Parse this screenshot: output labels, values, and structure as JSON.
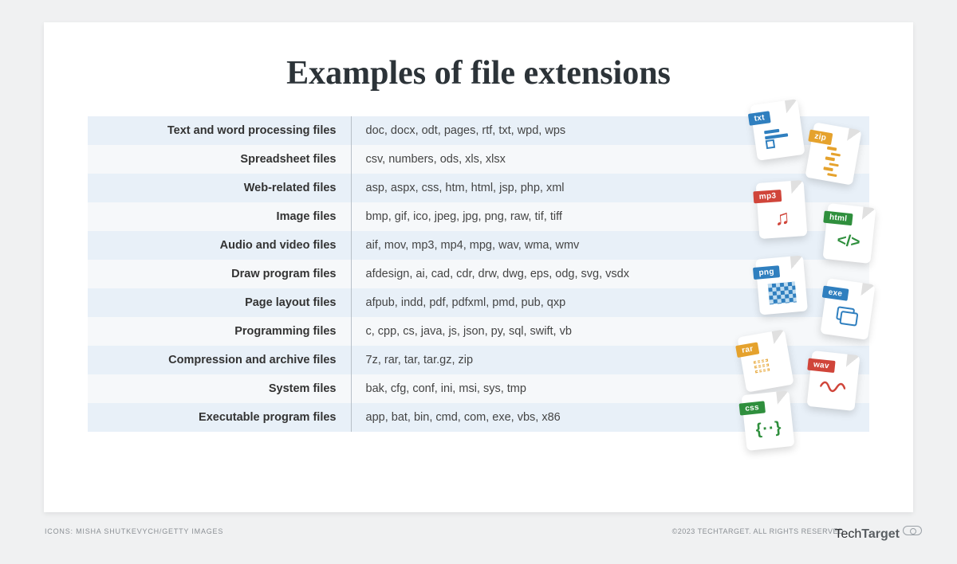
{
  "title": "Examples of file extensions",
  "rows": [
    {
      "category": "Text and word processing files",
      "values": "doc, docx, odt, pages, rtf, txt, wpd, wps"
    },
    {
      "category": "Spreadsheet files",
      "values": "csv, numbers, ods, xls, xlsx"
    },
    {
      "category": "Web-related files",
      "values": "asp, aspx, css, htm, html, jsp, php, xml"
    },
    {
      "category": "Image files",
      "values": "bmp, gif, ico, jpeg, jpg, png, raw, tif, tiff"
    },
    {
      "category": "Audio and video files",
      "values": "aif, mov, mp3, mp4, mpg, wav, wma, wmv"
    },
    {
      "category": "Draw program files",
      "values": "afdesign, ai, cad, cdr, drw, dwg, eps, odg, svg, vsdx"
    },
    {
      "category": "Page layout files",
      "values": "afpub, indd, pdf, pdfxml, pmd, pub, qxp"
    },
    {
      "category": "Programming files",
      "values": "c, cpp, cs, java, js, json, py, sql, swift, vb"
    },
    {
      "category": "Compression and archive files",
      "values": "7z, rar, tar, tar.gz, zip"
    },
    {
      "category": "System files",
      "values": "bak, cfg, conf, ini, msi, sys, tmp"
    },
    {
      "category": "Executable program files",
      "values": "app, bat, bin, cmd, com, exe, vbs, x86"
    }
  ],
  "icons_credit": "ICONS: MISHA SHUTKEVYCH/GETTY IMAGES",
  "copyright": "©2023 TECHTARGET. ALL RIGHTS RESERVED",
  "brand_light": "Tech",
  "brand_bold": "Target",
  "file_icons": [
    {
      "label": "txt"
    },
    {
      "label": "zip"
    },
    {
      "label": "mp3"
    },
    {
      "label": "html"
    },
    {
      "label": "png"
    },
    {
      "label": "exe"
    },
    {
      "label": "rar"
    },
    {
      "label": "wav"
    },
    {
      "label": "css"
    }
  ]
}
